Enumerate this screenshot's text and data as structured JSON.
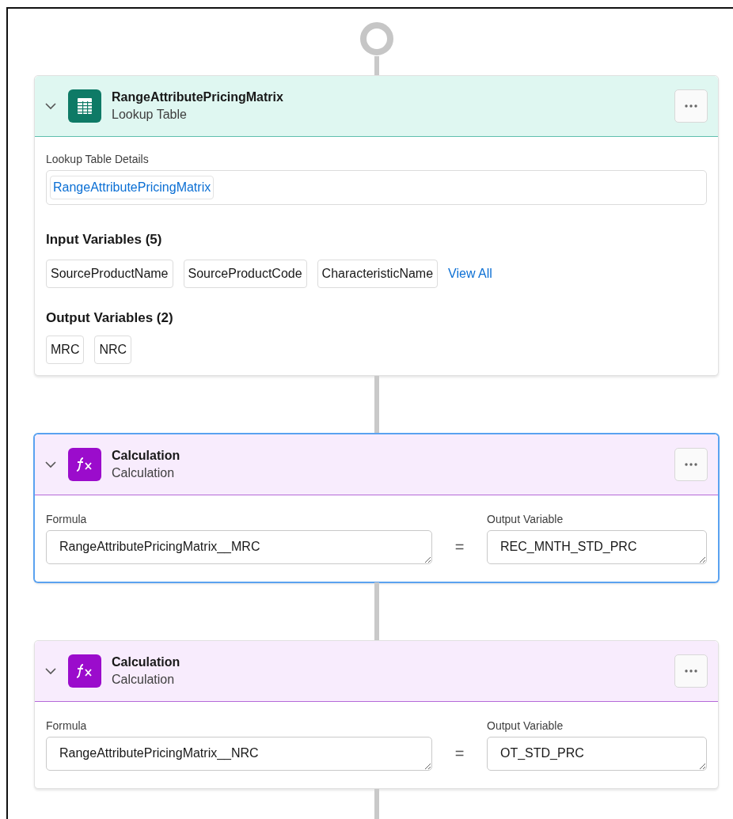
{
  "nodes": [
    {
      "kind": "lookup",
      "selected": false,
      "title": "RangeAttributePricingMatrix",
      "subtitle": "Lookup Table",
      "details_label": "Lookup Table Details",
      "details_value": "RangeAttributePricingMatrix",
      "input_heading": "Input Variables (5)",
      "inputs": [
        "SourceProductName",
        "SourceProductCode",
        "CharacteristicName"
      ],
      "view_all": "View All",
      "output_heading": "Output Variables (2)",
      "outputs": [
        "MRC",
        "NRC"
      ]
    },
    {
      "kind": "calculation",
      "selected": true,
      "title": "Calculation",
      "subtitle": "Calculation",
      "formula_label": "Formula",
      "formula": "RangeAttributePricingMatrix__MRC",
      "equals": "=",
      "output_label": "Output Variable",
      "output": "REC_MNTH_STD_PRC"
    },
    {
      "kind": "calculation",
      "selected": false,
      "title": "Calculation",
      "subtitle": "Calculation",
      "formula_label": "Formula",
      "formula": "RangeAttributePricingMatrix__NRC",
      "equals": "=",
      "output_label": "Output Variable",
      "output": "OT_STD_PRC"
    }
  ]
}
